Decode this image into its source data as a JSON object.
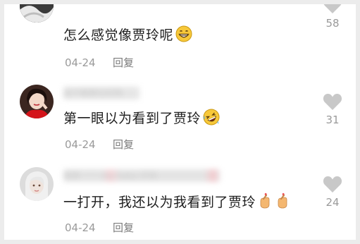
{
  "comments": [
    {
      "username": "",
      "text": "怎么感觉像贾玲呢",
      "emoji": "grinning-face",
      "date": "04-24",
      "reply_label": "回复",
      "likes": "58"
    },
    {
      "username": "这个昵称已打码",
      "text": "第一眼以为看到了贾玲",
      "emoji": "rolling-on-floor-laughing",
      "date": "04-24",
      "reply_label": "回复",
      "likes": "31"
    },
    {
      "username": "昵称 ♡♡ my baby 打码",
      "text": "一打开，我还以为我看到了贾玲",
      "emoji": "finger-heart x2",
      "date": "04-24",
      "reply_label": "回复",
      "likes": "24"
    }
  ],
  "colors": {
    "like_icon": "#c8c8c8",
    "meta_text": "#9a9a9a"
  }
}
